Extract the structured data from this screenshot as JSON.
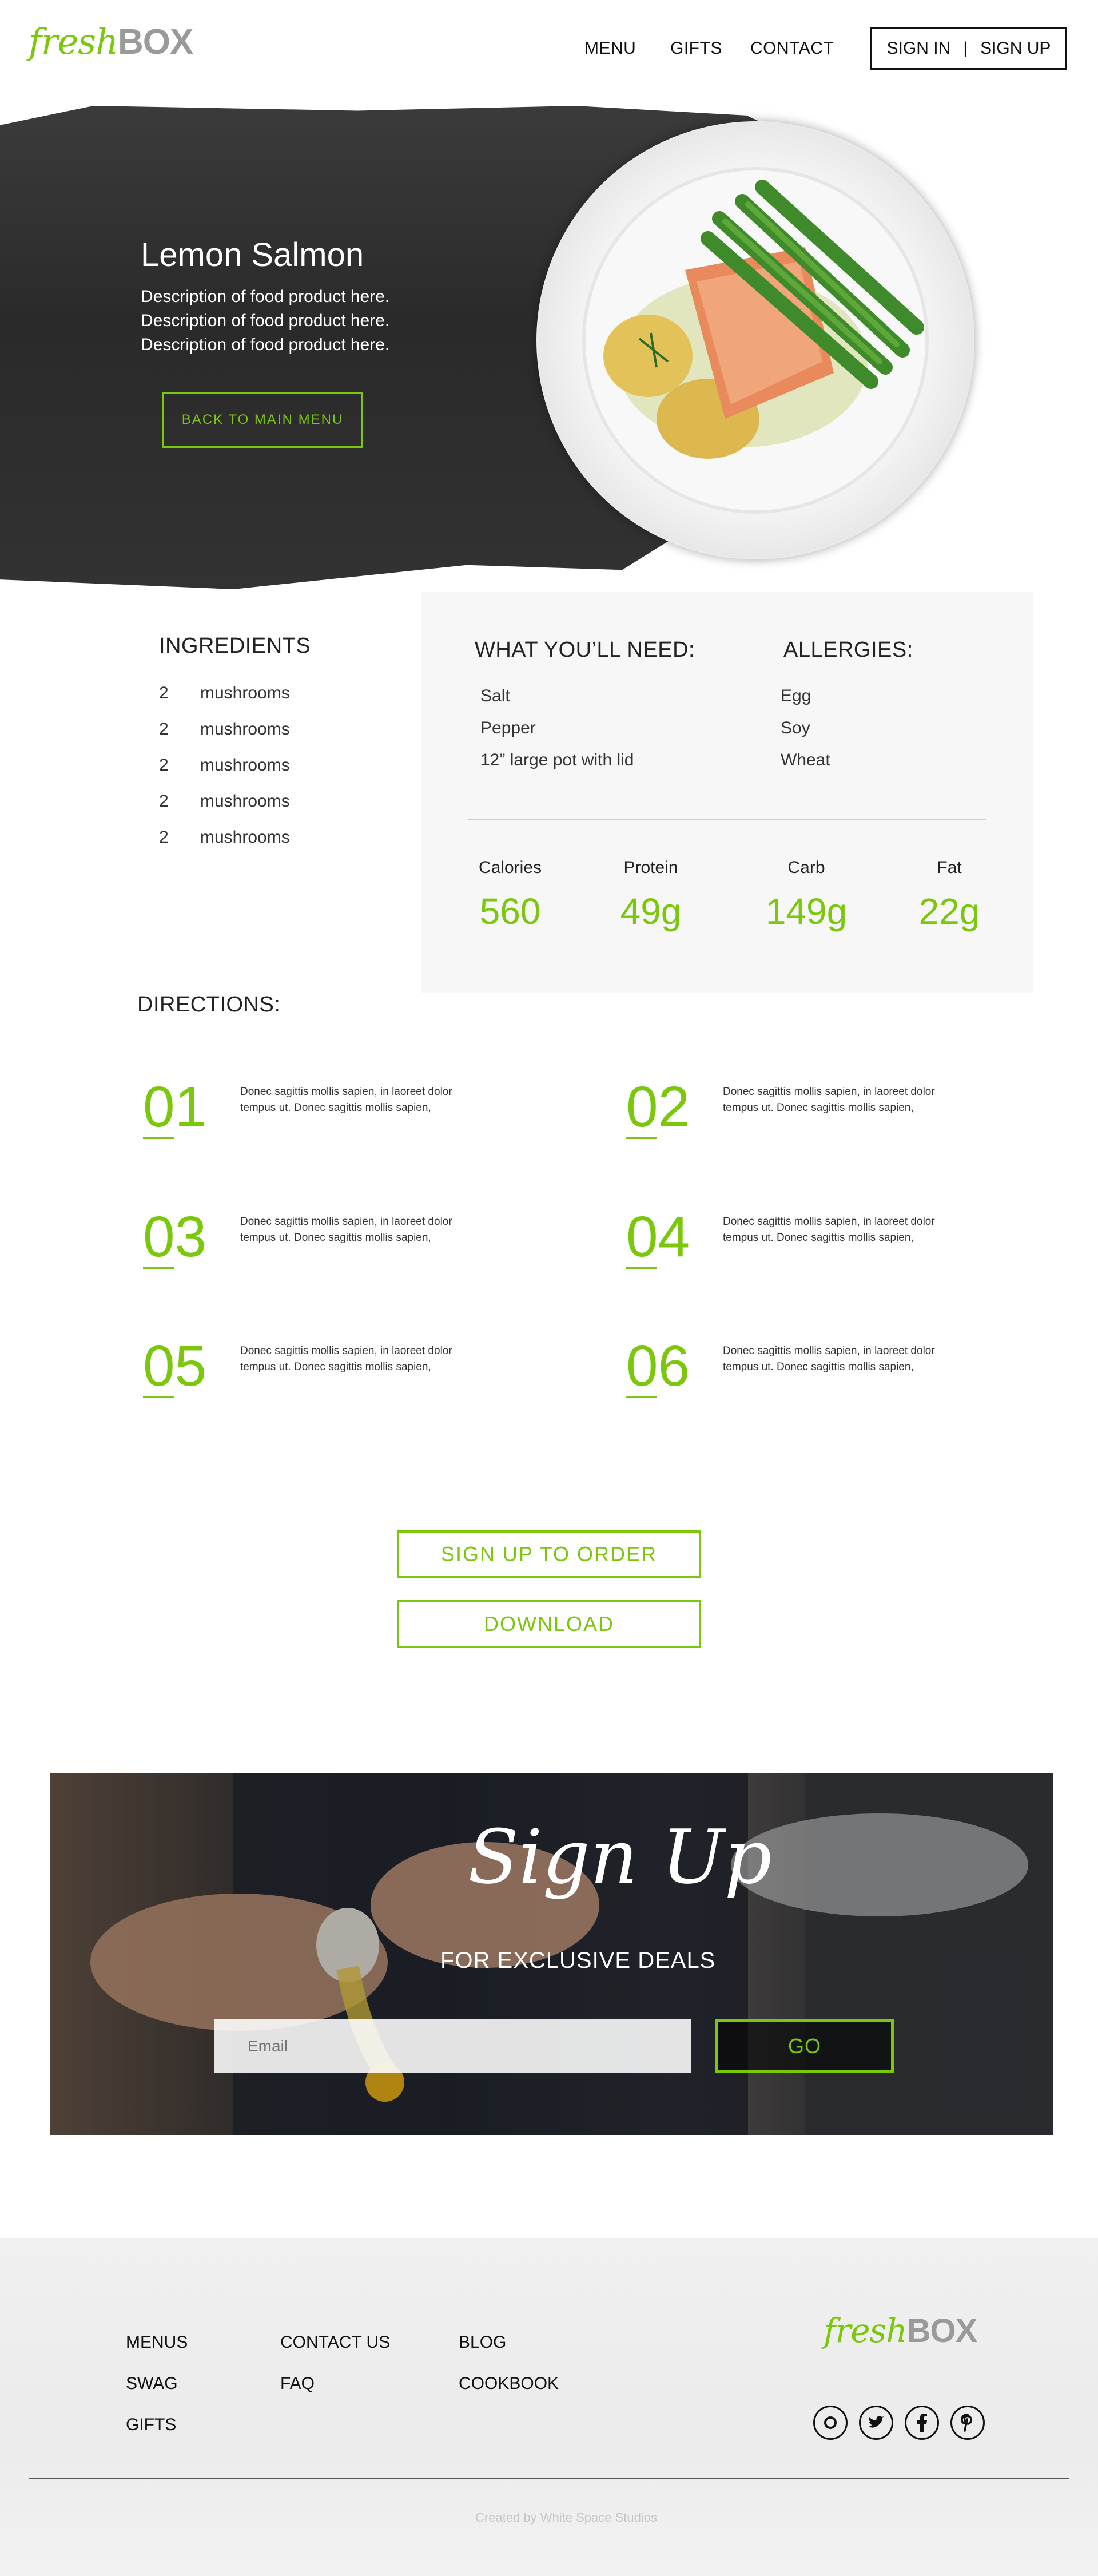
{
  "header": {
    "logo_fresh": "fresh",
    "logo_box": "BOX",
    "nav": [
      "MENU",
      "GIFTS",
      "CONTACT"
    ],
    "sign_in": "SIGN IN",
    "separator": "|",
    "sign_up": "SIGN UP"
  },
  "hero": {
    "title": "Lemon Salmon",
    "description": [
      "Description of food product here.",
      "Description of food product here.",
      "Description of food product here."
    ],
    "back_button": "BACK TO MAIN MENU"
  },
  "ingredients": {
    "heading": "INGREDIENTS",
    "items": [
      {
        "qty": "2",
        "name": "mushrooms"
      },
      {
        "qty": "2",
        "name": "mushrooms"
      },
      {
        "qty": "2",
        "name": "mushrooms"
      },
      {
        "qty": "2",
        "name": "mushrooms"
      },
      {
        "qty": "2",
        "name": "mushrooms"
      }
    ]
  },
  "need": {
    "heading": "WHAT YOU’LL NEED:",
    "items": [
      "Salt",
      "Pepper",
      "12” large pot with lid"
    ]
  },
  "allergies": {
    "heading": "ALLERGIES:",
    "items": [
      "Egg",
      "Soy",
      "Wheat"
    ]
  },
  "nutrition": [
    {
      "label": "Calories",
      "value": "560"
    },
    {
      "label": "Protein",
      "value": "49g"
    },
    {
      "label": "Carb",
      "value": "149g"
    },
    {
      "label": "Fat",
      "value": "22g"
    }
  ],
  "directions": {
    "heading": "DIRECTIONS:",
    "steps": [
      {
        "num": "01",
        "text": "Donec sagittis mollis sapien, in laoreet dolor tempus ut. Donec sagittis mollis sapien,"
      },
      {
        "num": "02",
        "text": "Donec sagittis mollis sapien, in laoreet dolor tempus ut. Donec sagittis mollis sapien,"
      },
      {
        "num": "03",
        "text": "Donec sagittis mollis sapien, in laoreet dolor tempus ut. Donec sagittis mollis sapien,"
      },
      {
        "num": "04",
        "text": "Donec sagittis mollis sapien, in laoreet dolor tempus ut. Donec sagittis mollis sapien,"
      },
      {
        "num": "05",
        "text": "Donec sagittis mollis sapien, in laoreet dolor tempus ut. Donec sagittis mollis sapien,"
      },
      {
        "num": "06",
        "text": "Donec sagittis mollis sapien, in laoreet dolor tempus ut. Donec sagittis mollis sapien,"
      }
    ]
  },
  "cta": {
    "sign_up_to_order": "SIGN UP TO ORDER",
    "download": "DOWNLOAD"
  },
  "banner": {
    "script_title": "Sign Up",
    "subtitle": "FOR EXCLUSIVE DEALS",
    "email_placeholder": "Email",
    "go": "GO"
  },
  "footer": {
    "col1": [
      "MENUS",
      "SWAG",
      "GIFTS"
    ],
    "col2": [
      "CONTACT US",
      "FAQ"
    ],
    "col3": [
      "BLOG",
      "COOKBOOK"
    ],
    "social_icons": [
      "instagram-icon",
      "twitter-icon",
      "facebook-icon",
      "pinterest-icon"
    ],
    "credit": "Created by White Space Studios"
  },
  "colors": {
    "accent": "#7ac70c",
    "hero_dark": "#2e2e2e",
    "panel_bg": "#f7f7f7",
    "footer_bg": "#eeeeee"
  }
}
